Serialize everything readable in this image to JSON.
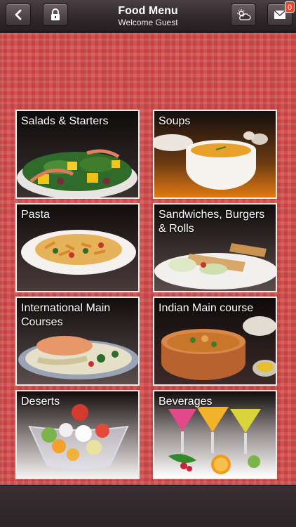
{
  "header": {
    "title": "Food Menu",
    "subtitle": "Welcome Guest",
    "back_icon": "back-arrow-icon",
    "lock_icon": "lock-icon",
    "weather_icon": "weather-icon",
    "mail_icon": "mail-icon",
    "mail_badge": "0"
  },
  "menu": {
    "categories": [
      {
        "label": "Salads & Starters"
      },
      {
        "label": "Soups"
      },
      {
        "label": "Pasta"
      },
      {
        "label": "Sandwiches, Burgers & Rolls"
      },
      {
        "label": "International Main Courses"
      },
      {
        "label": "Indian Main course"
      },
      {
        "label": "Deserts"
      },
      {
        "label": "Beverages"
      }
    ]
  },
  "colors": {
    "background": "#c9403f",
    "bar": "#2f2729",
    "badge": "#e3462b"
  }
}
